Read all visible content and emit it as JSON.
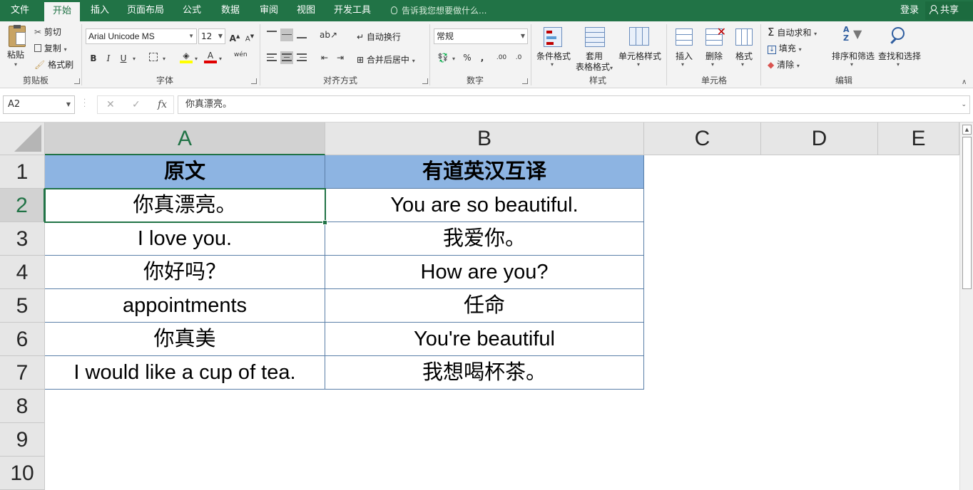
{
  "menu": {
    "tabs": [
      "文件",
      "开始",
      "插入",
      "页面布局",
      "公式",
      "数据",
      "审阅",
      "视图",
      "开发工具"
    ],
    "active_tab": "开始",
    "tell_me": "告诉我您想要做什么...",
    "login": "登录",
    "share": "共享"
  },
  "ribbon": {
    "clipboard": {
      "paste": "粘贴",
      "cut": "剪切",
      "copy": "复制",
      "format_painter": "格式刷",
      "group": "剪贴板"
    },
    "font": {
      "name": "Arial Unicode MS",
      "size": "12",
      "grow": "A",
      "shrink": "A",
      "bold": "B",
      "italic": "I",
      "underline": "U",
      "font_color": "A",
      "wen": "wén",
      "group": "字体"
    },
    "alignment": {
      "wrap": "自动换行",
      "merge": "合并后居中",
      "group": "对齐方式"
    },
    "number": {
      "format": "常规",
      "percent": "%",
      "comma": ",",
      "inc_decimal": ".00",
      "dec_decimal": ".0",
      "group": "数字"
    },
    "styles": {
      "conditional": "条件格式",
      "table_format_1": "套用",
      "table_format_2": "表格格式",
      "cell_styles": "单元格样式",
      "group": "样式"
    },
    "cells": {
      "insert": "插入",
      "delete": "删除",
      "format": "格式",
      "group": "单元格"
    },
    "editing": {
      "autosum": "自动求和",
      "fill": "填充",
      "clear": "清除",
      "sort_filter": "排序和筛选",
      "find_select": "查找和选择",
      "group": "编辑"
    }
  },
  "formula_bar": {
    "name_box": "A2",
    "cancel": "✕",
    "enter": "✓",
    "fx": "fx",
    "content": "你真漂亮。"
  },
  "sheet": {
    "columns": [
      "A",
      "B",
      "C",
      "D",
      "E"
    ],
    "selected_column": "A",
    "rows": [
      "1",
      "2",
      "3",
      "4",
      "5",
      "6",
      "7",
      "8",
      "9",
      "10"
    ],
    "selected_row": "2",
    "table": {
      "headers": [
        "原文",
        "有道英汉互译"
      ],
      "rows": [
        [
          "你真漂亮。",
          "You are so beautiful."
        ],
        [
          "I love you.",
          "我爱你。"
        ],
        [
          "你好吗？",
          "How are you?"
        ],
        [
          "appointments",
          "任命"
        ],
        [
          "你真美",
          "You're beautiful"
        ],
        [
          "I would like a cup of tea.",
          "我想喝杯茶。"
        ]
      ]
    },
    "header_fill": "#8db4e2",
    "accent": "#217346"
  }
}
